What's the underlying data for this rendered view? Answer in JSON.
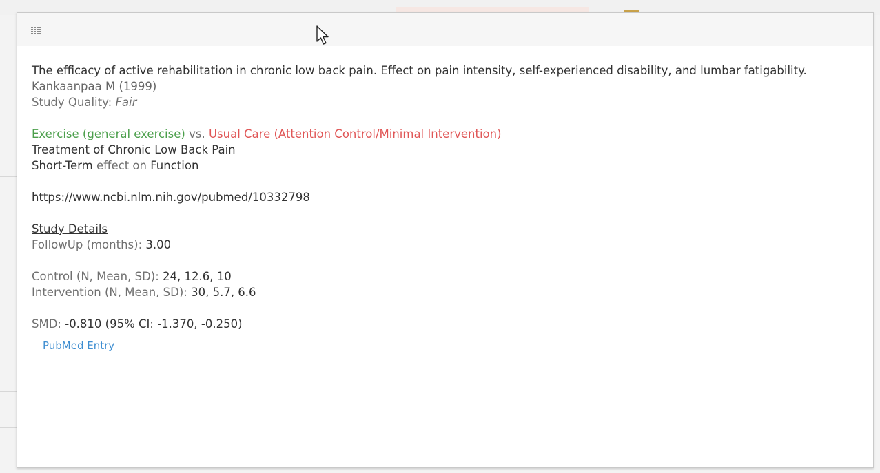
{
  "article": {
    "title": "The efficacy of active rehabilitation in chronic low back pain. Effect on pain intensity, self-experienced disability, and lumbar fatigability.",
    "author": "Kankaanpaa M (1999)",
    "quality_label": "Study Quality: ",
    "quality_value": "Fair"
  },
  "comparison": {
    "treatment": "Exercise (general exercise)",
    "vs": " vs. ",
    "control": "Usual Care (Attention Control/Minimal Intervention)",
    "treatment_of_prefix": "Treatment of ",
    "condition": "Chronic Low Back Pain",
    "term": "Short-Term",
    "effect_on": " effect on ",
    "outcome": "Function"
  },
  "url": "https://www.ncbi.nlm.nih.gov/pubmed/10332798",
  "details": {
    "heading": "Study Details",
    "followup_label": "FollowUp (months): ",
    "followup_value": "3.00",
    "control_label": "Control (N, Mean, SD): ",
    "control_value": "24, 12.6, 10",
    "intervention_label": "Intervention (N, Mean, SD): ",
    "intervention_value": "30, 5.7, 6.6",
    "smd_label": "SMD: ",
    "smd_value": "-0.810 (95% CI: -1.370, -0.250)"
  },
  "pubmed_link": "PubMed Entry",
  "colors": {
    "treatment": "#4b9f4b",
    "control": "#e05656",
    "link": "#3e8ed1"
  },
  "icons": [
    "grid-icon",
    "mouse-cursor-icon"
  ]
}
